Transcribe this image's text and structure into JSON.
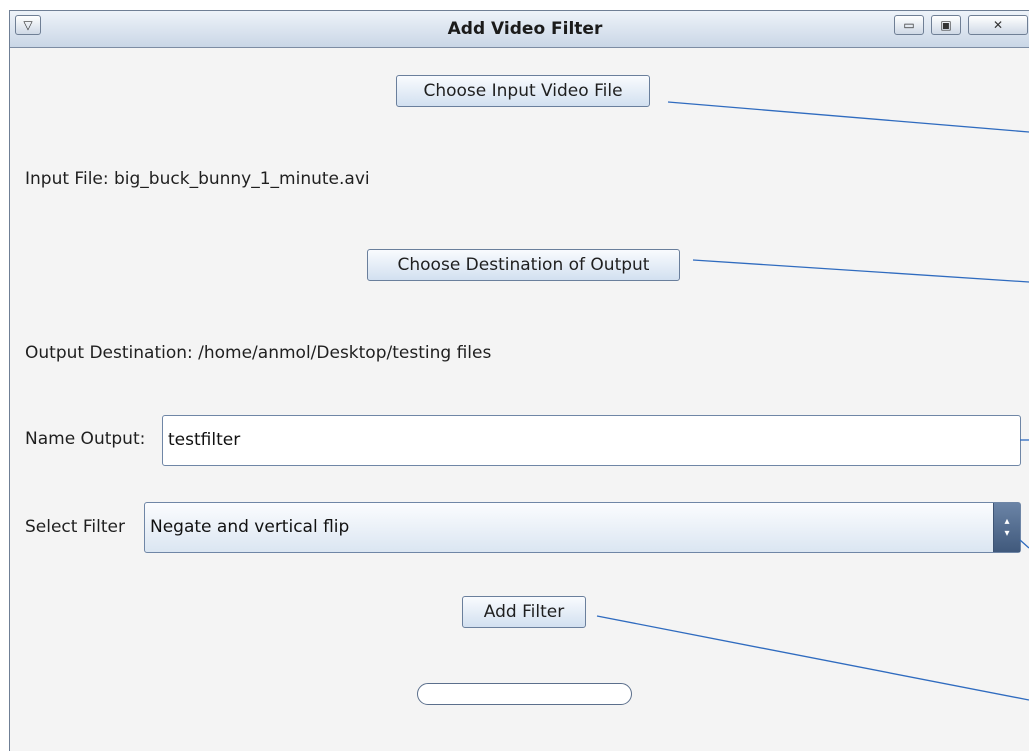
{
  "window": {
    "title": "Add Video Filter",
    "menu_glyph": "▽",
    "minimize_glyph": "▭",
    "maximize_glyph": "▣",
    "close_glyph": "✕"
  },
  "buttons": {
    "choose_input": "Choose Input Video File",
    "choose_destination": "Choose Destination of Output",
    "add_filter": "Add Filter"
  },
  "input_file": {
    "label": "Input File: big_buck_bunny_1_minute.avi"
  },
  "output_destination": {
    "label": "Output Destination: /home/anmol/Desktop/testing files"
  },
  "name_output": {
    "label": "Name Output:",
    "value": "testfilter"
  },
  "select_filter": {
    "label": "Select Filter",
    "selected": "Negate and vertical flip"
  },
  "progress": {
    "fraction": 0
  },
  "colors": {
    "connector_line": "#2f6bbf",
    "titlebar_top": "#eef3f9",
    "button_bottom": "#d2e0f0"
  }
}
